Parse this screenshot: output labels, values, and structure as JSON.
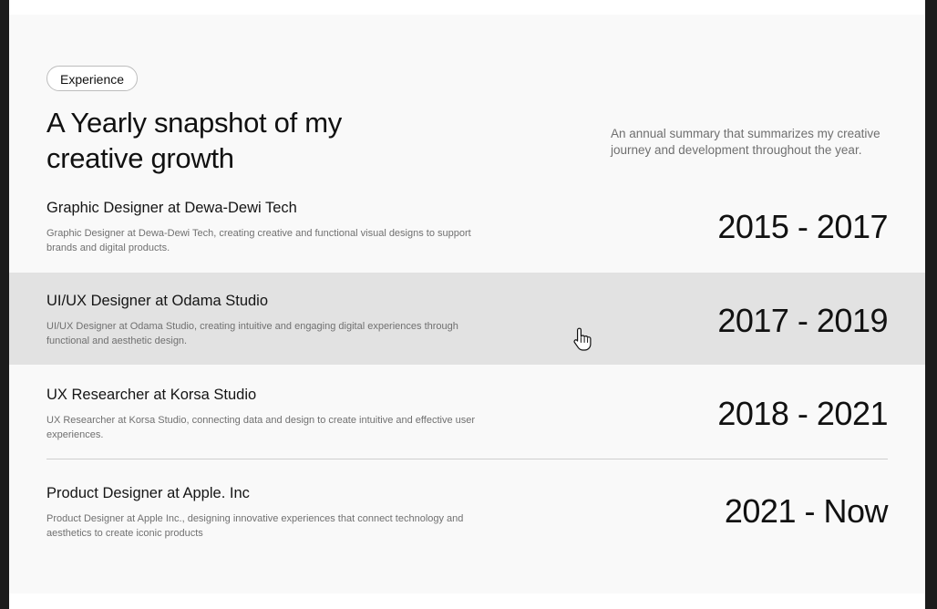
{
  "section": {
    "badge": "Experience",
    "headline": "A Yearly snapshot of my creative growth",
    "summary": "An annual summary that summarizes my creative journey and development throughout the year."
  },
  "experience": [
    {
      "title": "Graphic Designer at Dewa-Dewi Tech",
      "description": "Graphic Designer at Dewa-Dewi Tech, creating creative and functional visual designs to support brands and digital products.",
      "years": "2015 - 2017"
    },
    {
      "title": "UI/UX Designer at Odama Studio",
      "description": "UI/UX Designer at Odama Studio, creating intuitive and engaging digital experiences through functional and aesthetic design.",
      "years": "2017 - 2019"
    },
    {
      "title": "UX Researcher at Korsa Studio",
      "description": "UX Researcher at Korsa Studio, connecting data and design to create intuitive and effective user experiences.",
      "years": "2018 - 2021"
    },
    {
      "title": "Product Designer at Apple. Inc",
      "description": "Product Designer at Apple Inc., designing innovative experiences that connect technology and aesthetics to create iconic products",
      "years": "2021 - Now"
    }
  ],
  "colors": {
    "section_background": "#f9f9f9",
    "hover_row_background": "#e2e2e2",
    "text_primary": "#111111",
    "text_secondary": "#707070"
  },
  "cursor": {
    "icon": "hand-pointer-icon"
  }
}
